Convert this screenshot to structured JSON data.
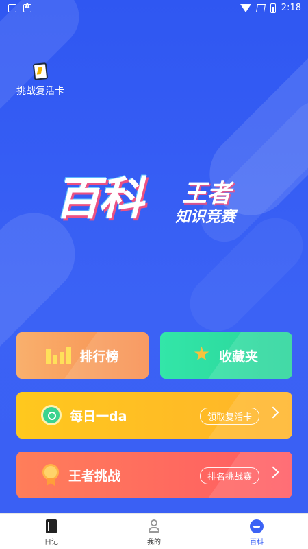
{
  "status_bar": {
    "time": "2:18"
  },
  "revive_card": {
    "label": "挑战复活卡"
  },
  "logo": {
    "main": "百科",
    "sub1": "王者",
    "sub2": "知识竞赛"
  },
  "buttons": {
    "rank": {
      "label": "排行榜"
    },
    "favorites": {
      "label": "收藏夹"
    },
    "daily": {
      "label": "每日一da",
      "pill": "领取复活卡"
    },
    "king": {
      "label": "王者挑战",
      "pill": "排名挑战赛"
    }
  },
  "bottom_nav": {
    "items": [
      {
        "label": "日记",
        "icon": "diary-icon"
      },
      {
        "label": "我的",
        "icon": "user-icon"
      },
      {
        "label": "百科",
        "icon": "baike-icon",
        "active": true
      }
    ]
  },
  "colors": {
    "background": "#3b62f5",
    "rank": "#f89a5a",
    "favorites": "#2fdca0",
    "daily": "#ffc020",
    "king": "#ff6a5f",
    "nav_active": "#3b62f5"
  }
}
